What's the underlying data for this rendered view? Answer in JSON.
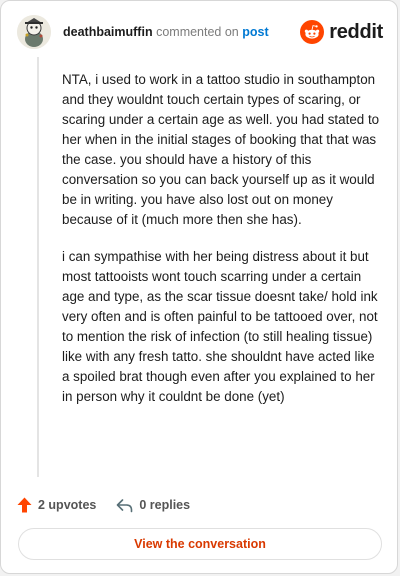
{
  "header": {
    "username": "deathbaimuffin",
    "action_text": "commented on",
    "post_link": "post",
    "brand": "reddit"
  },
  "comment": {
    "paragraphs": [
      "NTA, i used to work in a tattoo studio in southampton and they wouldnt touch certain types of scaring, or scaring under a certain age as well. you had stated to her when in the initial stages of booking that that was the case. you should have a history of this conversation so you can back yourself up as it would be in writing. you have also lost out on money because of it (much more then she has).",
      "i can sympathise with her being distress about it but most tattooists wont touch scarring under a certain age and type, as the scar tissue doesnt take/ hold ink very often and is often painful to be tattooed over, not to mention the risk of infection (to still healing tissue) like with any fresh tatto. she shouldnt have acted like a spoiled brat though even after you explained to her in person why it couldnt be done (yet)"
    ]
  },
  "footer": {
    "upvotes": "2 upvotes",
    "replies": "0 replies",
    "view_button": "View the conversation"
  },
  "colors": {
    "brand_orange": "#ff4500",
    "link_blue": "#0079d3",
    "button_text": "#d93900"
  },
  "icons": [
    "avatar",
    "reddit-logo-icon",
    "upvote-icon",
    "reply-icon"
  ]
}
